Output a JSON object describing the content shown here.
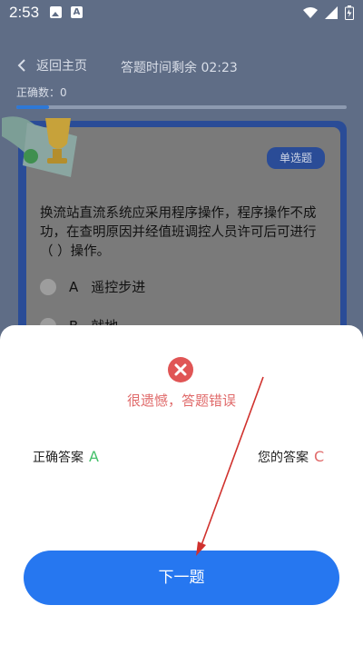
{
  "status_bar": {
    "time": "2:53"
  },
  "header": {
    "back_label": "返回主页",
    "timer_text": "答题时间剩余 02:23",
    "correct_count": "正确数：0",
    "progress": 0.1
  },
  "question": {
    "type_tag": "单选题",
    "text": "换流站直流系统应采用程序操作，程序操作不成功，在查明原因并经值班调控人员许可后可进行（   ）操作。",
    "options": [
      {
        "letter": "A",
        "text": "遥控步进"
      },
      {
        "letter": "B",
        "text": "就地"
      }
    ]
  },
  "result_sheet": {
    "message": "很遗憾，答题错误",
    "correct_answer_label": "正确答案",
    "correct_answer_value": "A",
    "your_answer_label": "您的答案",
    "your_answer_value": "C",
    "next_button": "下一题"
  },
  "colors": {
    "overlay_bg": "#5f6d86",
    "card_border": "#2a4c97",
    "correct_green": "#44c06a",
    "wrong_red": "#e06a6a",
    "primary_button": "#2677f0"
  }
}
